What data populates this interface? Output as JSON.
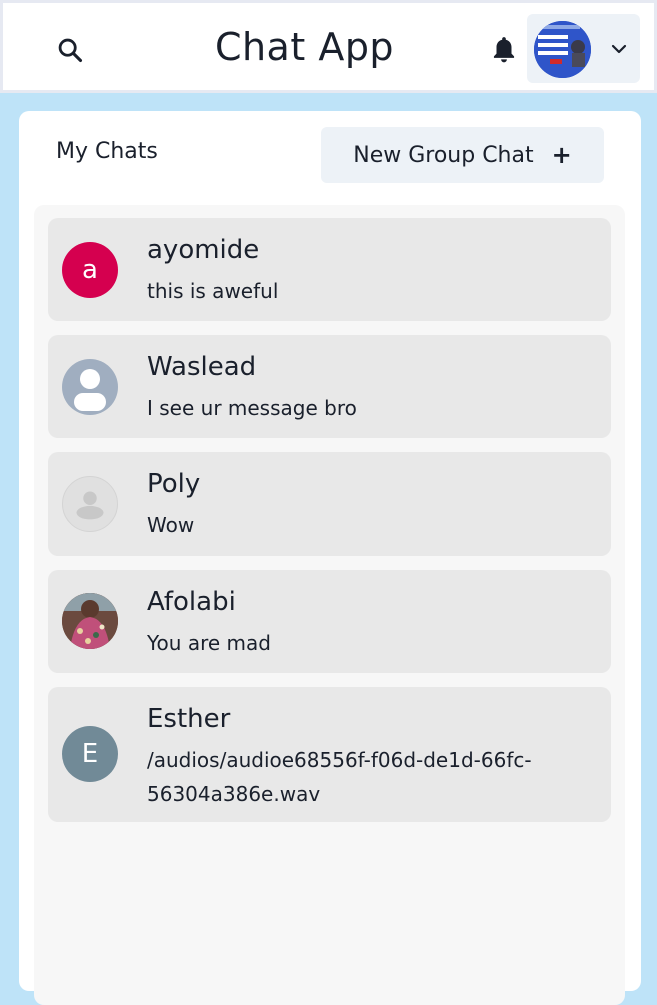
{
  "header": {
    "title": "Chat App",
    "search_icon": "search-icon",
    "bell_icon": "bell-icon",
    "chevron_icon": "chevron-down-icon"
  },
  "sidebar": {
    "heading": "My Chats",
    "new_group_label": "New Group Chat",
    "new_group_icon": "+"
  },
  "chats": [
    {
      "name": "ayomide",
      "message": "this is aweful",
      "avatar_letter": "a",
      "avatar_color": "#d5004f"
    },
    {
      "name": "Waslead",
      "message": "I see ur message bro",
      "avatar_type": "default-user"
    },
    {
      "name": "Poly",
      "message": "Wow",
      "avatar_type": "default-user-light"
    },
    {
      "name": "Afolabi",
      "message": "You are mad",
      "avatar_type": "photo"
    },
    {
      "name": "Esther",
      "message": "/audios/audioe68556f-f06d-de1d-66fc-56304a386e.wav",
      "avatar_letter": "E",
      "avatar_color": "#718a97"
    }
  ]
}
